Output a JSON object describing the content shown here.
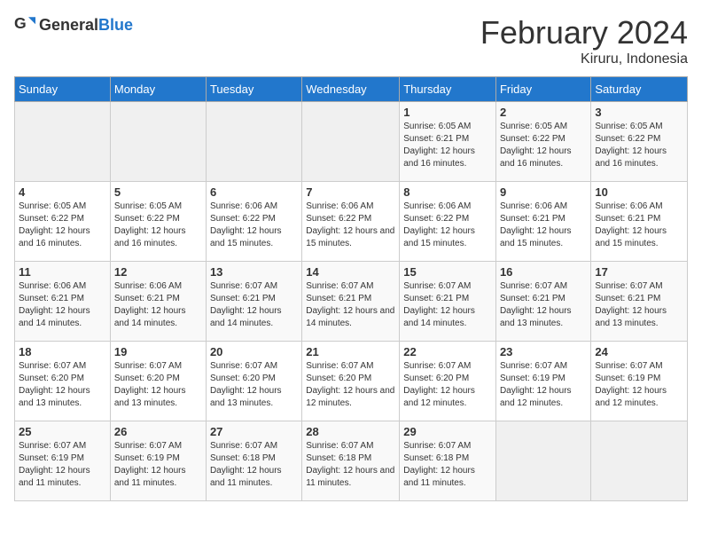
{
  "logo": {
    "text_general": "General",
    "text_blue": "Blue"
  },
  "header": {
    "month": "February 2024",
    "location": "Kiruru, Indonesia"
  },
  "weekdays": [
    "Sunday",
    "Monday",
    "Tuesday",
    "Wednesday",
    "Thursday",
    "Friday",
    "Saturday"
  ],
  "weeks": [
    [
      {
        "day": "",
        "sunrise": "",
        "sunset": "",
        "daylight": ""
      },
      {
        "day": "",
        "sunrise": "",
        "sunset": "",
        "daylight": ""
      },
      {
        "day": "",
        "sunrise": "",
        "sunset": "",
        "daylight": ""
      },
      {
        "day": "",
        "sunrise": "",
        "sunset": "",
        "daylight": ""
      },
      {
        "day": "1",
        "sunrise": "Sunrise: 6:05 AM",
        "sunset": "Sunset: 6:21 PM",
        "daylight": "Daylight: 12 hours and 16 minutes."
      },
      {
        "day": "2",
        "sunrise": "Sunrise: 6:05 AM",
        "sunset": "Sunset: 6:22 PM",
        "daylight": "Daylight: 12 hours and 16 minutes."
      },
      {
        "day": "3",
        "sunrise": "Sunrise: 6:05 AM",
        "sunset": "Sunset: 6:22 PM",
        "daylight": "Daylight: 12 hours and 16 minutes."
      }
    ],
    [
      {
        "day": "4",
        "sunrise": "Sunrise: 6:05 AM",
        "sunset": "Sunset: 6:22 PM",
        "daylight": "Daylight: 12 hours and 16 minutes."
      },
      {
        "day": "5",
        "sunrise": "Sunrise: 6:05 AM",
        "sunset": "Sunset: 6:22 PM",
        "daylight": "Daylight: 12 hours and 16 minutes."
      },
      {
        "day": "6",
        "sunrise": "Sunrise: 6:06 AM",
        "sunset": "Sunset: 6:22 PM",
        "daylight": "Daylight: 12 hours and 15 minutes."
      },
      {
        "day": "7",
        "sunrise": "Sunrise: 6:06 AM",
        "sunset": "Sunset: 6:22 PM",
        "daylight": "Daylight: 12 hours and 15 minutes."
      },
      {
        "day": "8",
        "sunrise": "Sunrise: 6:06 AM",
        "sunset": "Sunset: 6:22 PM",
        "daylight": "Daylight: 12 hours and 15 minutes."
      },
      {
        "day": "9",
        "sunrise": "Sunrise: 6:06 AM",
        "sunset": "Sunset: 6:21 PM",
        "daylight": "Daylight: 12 hours and 15 minutes."
      },
      {
        "day": "10",
        "sunrise": "Sunrise: 6:06 AM",
        "sunset": "Sunset: 6:21 PM",
        "daylight": "Daylight: 12 hours and 15 minutes."
      }
    ],
    [
      {
        "day": "11",
        "sunrise": "Sunrise: 6:06 AM",
        "sunset": "Sunset: 6:21 PM",
        "daylight": "Daylight: 12 hours and 14 minutes."
      },
      {
        "day": "12",
        "sunrise": "Sunrise: 6:06 AM",
        "sunset": "Sunset: 6:21 PM",
        "daylight": "Daylight: 12 hours and 14 minutes."
      },
      {
        "day": "13",
        "sunrise": "Sunrise: 6:07 AM",
        "sunset": "Sunset: 6:21 PM",
        "daylight": "Daylight: 12 hours and 14 minutes."
      },
      {
        "day": "14",
        "sunrise": "Sunrise: 6:07 AM",
        "sunset": "Sunset: 6:21 PM",
        "daylight": "Daylight: 12 hours and 14 minutes."
      },
      {
        "day": "15",
        "sunrise": "Sunrise: 6:07 AM",
        "sunset": "Sunset: 6:21 PM",
        "daylight": "Daylight: 12 hours and 14 minutes."
      },
      {
        "day": "16",
        "sunrise": "Sunrise: 6:07 AM",
        "sunset": "Sunset: 6:21 PM",
        "daylight": "Daylight: 12 hours and 13 minutes."
      },
      {
        "day": "17",
        "sunrise": "Sunrise: 6:07 AM",
        "sunset": "Sunset: 6:21 PM",
        "daylight": "Daylight: 12 hours and 13 minutes."
      }
    ],
    [
      {
        "day": "18",
        "sunrise": "Sunrise: 6:07 AM",
        "sunset": "Sunset: 6:20 PM",
        "daylight": "Daylight: 12 hours and 13 minutes."
      },
      {
        "day": "19",
        "sunrise": "Sunrise: 6:07 AM",
        "sunset": "Sunset: 6:20 PM",
        "daylight": "Daylight: 12 hours and 13 minutes."
      },
      {
        "day": "20",
        "sunrise": "Sunrise: 6:07 AM",
        "sunset": "Sunset: 6:20 PM",
        "daylight": "Daylight: 12 hours and 13 minutes."
      },
      {
        "day": "21",
        "sunrise": "Sunrise: 6:07 AM",
        "sunset": "Sunset: 6:20 PM",
        "daylight": "Daylight: 12 hours and 12 minutes."
      },
      {
        "day": "22",
        "sunrise": "Sunrise: 6:07 AM",
        "sunset": "Sunset: 6:20 PM",
        "daylight": "Daylight: 12 hours and 12 minutes."
      },
      {
        "day": "23",
        "sunrise": "Sunrise: 6:07 AM",
        "sunset": "Sunset: 6:19 PM",
        "daylight": "Daylight: 12 hours and 12 minutes."
      },
      {
        "day": "24",
        "sunrise": "Sunrise: 6:07 AM",
        "sunset": "Sunset: 6:19 PM",
        "daylight": "Daylight: 12 hours and 12 minutes."
      }
    ],
    [
      {
        "day": "25",
        "sunrise": "Sunrise: 6:07 AM",
        "sunset": "Sunset: 6:19 PM",
        "daylight": "Daylight: 12 hours and 11 minutes."
      },
      {
        "day": "26",
        "sunrise": "Sunrise: 6:07 AM",
        "sunset": "Sunset: 6:19 PM",
        "daylight": "Daylight: 12 hours and 11 minutes."
      },
      {
        "day": "27",
        "sunrise": "Sunrise: 6:07 AM",
        "sunset": "Sunset: 6:18 PM",
        "daylight": "Daylight: 12 hours and 11 minutes."
      },
      {
        "day": "28",
        "sunrise": "Sunrise: 6:07 AM",
        "sunset": "Sunset: 6:18 PM",
        "daylight": "Daylight: 12 hours and 11 minutes."
      },
      {
        "day": "29",
        "sunrise": "Sunrise: 6:07 AM",
        "sunset": "Sunset: 6:18 PM",
        "daylight": "Daylight: 12 hours and 11 minutes."
      },
      {
        "day": "",
        "sunrise": "",
        "sunset": "",
        "daylight": ""
      },
      {
        "day": "",
        "sunrise": "",
        "sunset": "",
        "daylight": ""
      }
    ]
  ]
}
